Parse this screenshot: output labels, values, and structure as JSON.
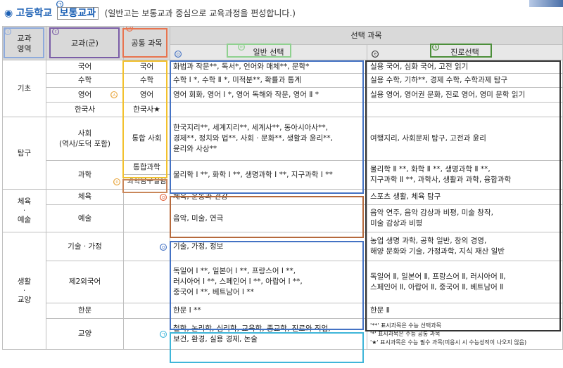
{
  "title": {
    "bullet": "◉",
    "marker": "㉠",
    "school": "고등학교",
    "subject": "보통교과",
    "note": "(일반고는 보통교과 중심으로 교육과정을 편성합니다.)"
  },
  "table": {
    "header": {
      "area": "교과\n영역",
      "subject_group": "교과(군)",
      "common": "공통 과목",
      "elective": "선택 과목",
      "general": "일반 선택",
      "career": "진로선택"
    },
    "markers": {
      "area": "ⓛ",
      "group": "ⓒ",
      "common": "㉣",
      "general_left": "㉧",
      "general_right": "ⓜ",
      "career_left": "ⓔ",
      "career_right": "ⓗ",
      "english": "㉦",
      "science_lab": "ⓞ",
      "pe_arts": "㉧",
      "tech": "㉧",
      "liberal": "㉠"
    },
    "areas": {
      "basic": "기초",
      "inquiry": "탐구",
      "pe_arts": "체육\n·\n예술",
      "life": "생활\n·\n교양"
    },
    "rows": [
      {
        "group": "국어",
        "common": "국어",
        "general": "화법과 작문**, 독서*, 언어와 매체**, 문학*",
        "career": "실용 국어, 심화 국어, 고전 읽기"
      },
      {
        "group": "수학",
        "common": "수학",
        "general": "수학 Ⅰ *, 수학 Ⅱ *, 미적분**, 확률과 통계",
        "career": "실용 수학, 기하**, 경제 수학, 수학과제 탐구"
      },
      {
        "group": "영어",
        "common": "영어",
        "general": "영어 회화, 영어 Ⅰ *, 영어 독해와 작문, 영어 Ⅱ *",
        "career": "실용 영어, 영어권 문화, 진로 영어, 영미 문학 읽기"
      },
      {
        "group": "한국사",
        "common": "한국사★",
        "general": "",
        "career": ""
      },
      {
        "group": "사회\n(역사/도덕 포함)",
        "common": "통합 사회",
        "general": "한국지리**, 세계지리**, 세계사**, 동아시아사**,\n경제**, 정치와 법**, 사회 · 문화**, 생활과 윤리**,\n윤리와 사상**",
        "career": "여행지리, 사회문제 탐구, 고전과 윤리"
      },
      {
        "group": "과학",
        "common": "통합과학",
        "common2": "과학탐구실험",
        "general": "물리학 Ⅰ **, 화학 Ⅰ **, 생명과학 Ⅰ **, 지구과학 Ⅰ **",
        "career": "물리학 Ⅱ **, 화학 Ⅱ **, 생명과학 Ⅱ **,\n지구과학 Ⅱ **, 과학사, 생활과 과학, 융합과학"
      },
      {
        "group": "체육",
        "common": "",
        "general": "체육, 운동과 건강",
        "career": "스포츠 생활, 체육 탐구"
      },
      {
        "group": "예술",
        "common": "",
        "general": "음악, 미술, 연극",
        "career": "음악 연주, 음악 감상과 비평, 미술 창작,\n미술 감상과 비평"
      },
      {
        "group": "기술 · 가정",
        "common": "",
        "general": "기술, 가정, 정보",
        "career": "농업 생명 과학, 공학 일반, 창의 경영,\n해양 문화와 기술, 가정과학, 지식 재산 일반"
      },
      {
        "group": "제2외국어",
        "common": "",
        "general": "독일어 Ⅰ **, 일본어 Ⅰ **, 프랑스어 Ⅰ **,\n러시아어 Ⅰ **, 스페인어 Ⅰ **, 아랍어 Ⅰ **,\n중국어 Ⅰ **, 베트남어 Ⅰ **",
        "career": "독일어 Ⅱ, 일본어 Ⅱ, 프랑스어 Ⅱ, 러시아어 Ⅱ,\n스페인어 Ⅱ, 아랍어 Ⅱ, 중국어 Ⅱ, 베트남어 Ⅱ"
      },
      {
        "group": "한문",
        "common": "",
        "general": "한문 Ⅰ **",
        "career": "한문 Ⅱ"
      },
      {
        "group": "교양",
        "common": "",
        "general": "철학, 논리학, 심리학, 교육학, 종교학, 진로와 직업,\n보건, 환경, 실용 경제, 논술",
        "career": ""
      }
    ],
    "legend": [
      "'**' 표시과목은 수능 선택과목",
      "'*' 표시과목은 수능 공통 과목",
      "'★' 표시과목은 수능 필수 과목(미응시 시 수능성적이 나오지 않음)"
    ]
  },
  "colors": {
    "title_blue": "#1a5fb4",
    "area_box": "#8eaadb",
    "group_box": "#7b5ea7",
    "common_head_box": "#e8744f",
    "common_box": "#f2c12e",
    "general_head_box": "#8fd18f",
    "career_head_box": "#4c8f3a",
    "general_box": "#4472c4",
    "career_box": "#333333",
    "science_lab_box": "#c9875a",
    "pe_arts_box": "#b5693c",
    "liberal_box": "#3fb6d9"
  }
}
